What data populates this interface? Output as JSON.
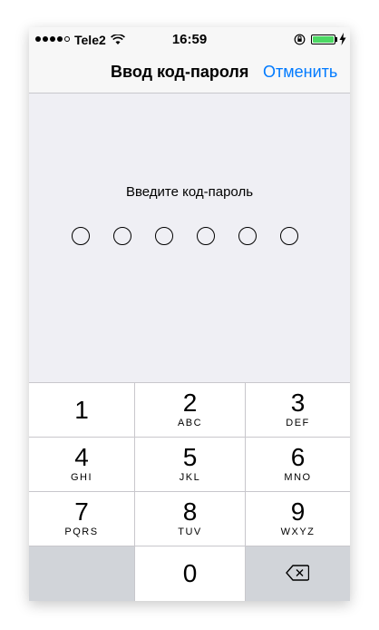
{
  "status_bar": {
    "carrier": "Tele2",
    "time": "16:59"
  },
  "nav": {
    "title": "Ввод код-пароля",
    "cancel_label": "Отменить",
    "accent_color": "#007aff"
  },
  "passcode": {
    "prompt": "Введите код-пароль",
    "digit_count": 6,
    "entered": 0
  },
  "keypad": {
    "keys": [
      {
        "digit": "1",
        "letters": ""
      },
      {
        "digit": "2",
        "letters": "ABC"
      },
      {
        "digit": "3",
        "letters": "DEF"
      },
      {
        "digit": "4",
        "letters": "GHI"
      },
      {
        "digit": "5",
        "letters": "JKL"
      },
      {
        "digit": "6",
        "letters": "MNO"
      },
      {
        "digit": "7",
        "letters": "PQRS"
      },
      {
        "digit": "8",
        "letters": "TUV"
      },
      {
        "digit": "9",
        "letters": "WXYZ"
      },
      {
        "digit": "0",
        "letters": ""
      }
    ],
    "delete_icon": "backspace-icon"
  }
}
